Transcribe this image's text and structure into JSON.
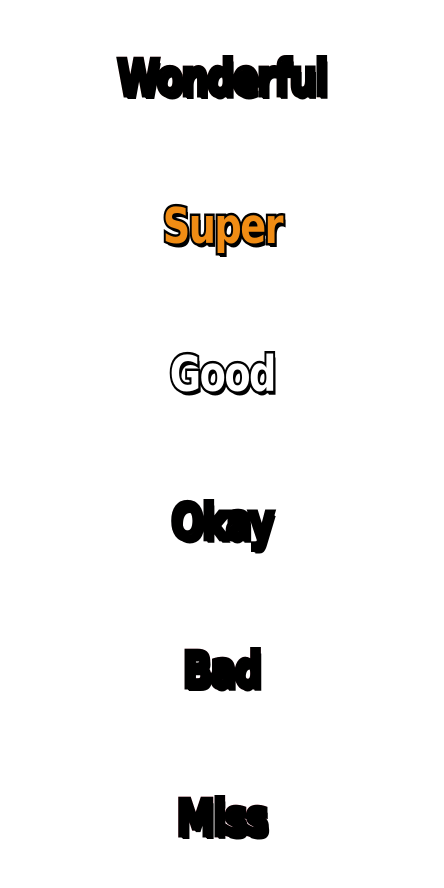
{
  "ratings": [
    {
      "label": "Wonderful",
      "color_top": "#f57e92",
      "color_bottom": "#f6a25a"
    },
    {
      "label": "Super",
      "color_top": "#f08c14",
      "color_bottom": "#f08c14"
    },
    {
      "label": "Good",
      "color_top": "#ffffff",
      "color_bottom": "#ffffff"
    },
    {
      "label": "Okay",
      "color_top": "#8e7b8c",
      "color_bottom": "#7d6476"
    },
    {
      "label": "Bad",
      "color_top": "#b63d57",
      "color_bottom": "#a63a53"
    },
    {
      "label": "Miss",
      "color_top": "#d8173c",
      "color_bottom": "#c01a40"
    }
  ],
  "outline_color": "#000000",
  "background_color": "#ffffff"
}
